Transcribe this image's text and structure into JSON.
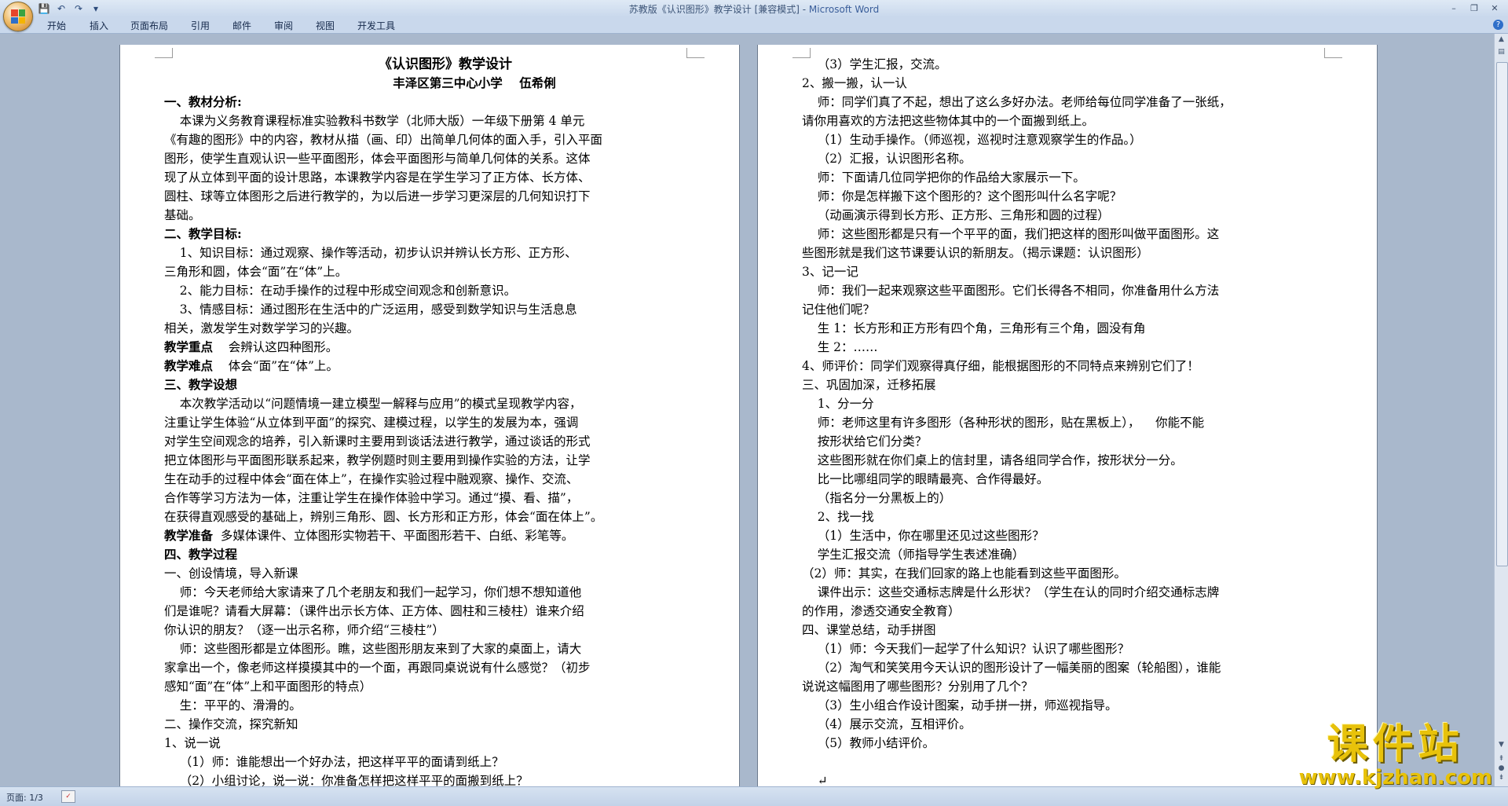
{
  "window": {
    "title": "苏教版《认识图形》教学设计 [兼容模式] - ",
    "app_name": "Microsoft Word",
    "minimize": "–",
    "restore": "❐",
    "close": "✕"
  },
  "quick_access": {
    "save": "💾",
    "undo": "↶",
    "redo": "↷",
    "more": "▾"
  },
  "ribbon_tabs": [
    "开始",
    "插入",
    "页面布局",
    "引用",
    "邮件",
    "审阅",
    "视图",
    "开发工具"
  ],
  "help": "?",
  "status": {
    "page": "页面: 1/3"
  },
  "watermark": {
    "title": "课件站",
    "url": "www.kjzhan.com"
  },
  "icons": {
    "office_button": "office-button-icon",
    "save": "save-icon",
    "undo": "undo-icon",
    "redo": "redo-icon",
    "help": "help-icon",
    "proofing": "proofing-icon"
  },
  "colors": {
    "title_bar": "#dfe9f5",
    "workspace": "#a9b8cc",
    "watermark": "#e8c20a"
  },
  "document": {
    "left_lines": [
      {
        "t": "《认识图形》教学设计",
        "s": "title"
      },
      {
        "t": "丰泽区第三中心小学    伍希俐",
        "s": "author"
      },
      {
        "t": "一、教材分析:",
        "s": "bold"
      },
      {
        "t": "    本课为义务教育课程标准实验教科书数学（北师大版）一年级下册第 4 单元"
      },
      {
        "t": "《有趣的图形》中的内容，教材从描（画、印）出简单几何体的面入手，引入平面"
      },
      {
        "t": "图形，使学生直观认识一些平面图形，体会平面图形与简单几何体的关系。这体"
      },
      {
        "t": "现了从立体到平面的设计思路，本课教学内容是在学生学习了正方体、长方体、"
      },
      {
        "t": "圆柱、球等立体图形之后进行教学的，为以后进一步学习更深层的几何知识打下"
      },
      {
        "t": "基础。"
      },
      {
        "t": "二、教学目标:",
        "s": "bold"
      },
      {
        "t": "    1、知识目标：通过观察、操作等活动，初步认识并辨认长方形、正方形、"
      },
      {
        "t": "三角形和圆，体会“面”在“体”上。"
      },
      {
        "t": "    2、能力目标：在动手操作的过程中形成空间观念和创新意识。"
      },
      {
        "t": "    3、情感目标：通过图形在生活中的广泛运用，感受到数学知识与生活息息"
      },
      {
        "t": "相关，激发学生对数学学习的兴趣。"
      },
      {
        "t": "教学重点",
        "s": "bold",
        "rest": "    会辨认这四种图形。"
      },
      {
        "t": "教学难点",
        "s": "bold",
        "rest": "    体会“面”在“体”上。"
      },
      {
        "t": "三、教学设想",
        "s": "bold"
      },
      {
        "t": "    本次教学活动以“问题情境一建立模型一解释与应用”的模式呈现教学内容，"
      },
      {
        "t": "注重让学生体验“从立体到平面”的探究、建模过程，以学生的发展为本，强调"
      },
      {
        "t": "对学生空间观念的培养，引入新课时主要用到谈话法进行教学，通过谈话的形式"
      },
      {
        "t": "把立体图形与平面图形联系起来，教学例题时则主要用到操作实验的方法，让学"
      },
      {
        "t": "生在动手的过程中体会“面在体上”，在操作实验过程中融观察、操作、交流、"
      },
      {
        "t": "合作等学习方法为一体，注重让学生在操作体验中学习。通过“摸、看、描”，"
      },
      {
        "t": "在获得直观感受的基础上，辨别三角形、圆、长方形和正方形，体会“面在体上”。"
      },
      {
        "t": "教学准备",
        "s": "bold",
        "rest": "  多媒体课件、立体图形实物若干、平面图形若干、白纸、彩笔等。"
      },
      {
        "t": "四、教学过程",
        "s": "bold"
      },
      {
        "t": "一、创设情境，导入新课"
      },
      {
        "t": "    师：今天老师给大家请来了几个老朋友和我们一起学习，你们想不想知道他"
      },
      {
        "t": "们是谁呢？请看大屏幕：（课件出示长方体、正方体、圆柱和三棱柱）谁来介绍"
      },
      {
        "t": "你认识的朋友？（逐一出示名称，师介绍“三棱柱”）"
      },
      {
        "t": "    师：这些图形都是立体图形。瞧，这些图形朋友来到了大家的桌面上，请大"
      },
      {
        "t": "家拿出一个，像老师这样摸摸其中的一个面，再跟同桌说说有什么感觉？（初步"
      },
      {
        "t": "感知“面”在“体”上和平面图形的特点）"
      },
      {
        "t": "    生：平平的、滑滑的。"
      },
      {
        "t": "二、操作交流，探究新知"
      },
      {
        "t": "1、说一说"
      },
      {
        "t": "    （1）师：谁能想出一个好办法，把这样平平的面请到纸上？"
      },
      {
        "t": "    （2）小组讨论，说一说：你准备怎样把这样平平的面搬到纸上？"
      }
    ],
    "right_lines": [
      {
        "t": "    （3）学生汇报，交流。"
      },
      {
        "t": "2、搬一搬，认一认"
      },
      {
        "t": "    师：同学们真了不起，想出了这么多好办法。老师给每位同学准备了一张纸，"
      },
      {
        "t": "请你用喜欢的方法把这些物体其中的一个面搬到纸上。"
      },
      {
        "t": "    （1）生动手操作。（师巡视，巡视时注意观察学生的作品。）"
      },
      {
        "t": "    （2）汇报，认识图形名称。"
      },
      {
        "t": "    师：下面请几位同学把你的作品给大家展示一下。"
      },
      {
        "t": "    师：你是怎样搬下这个图形的？这个图形叫什么名字呢？"
      },
      {
        "t": "    （动画演示得到长方形、正方形、三角形和圆的过程）"
      },
      {
        "t": "    师：这些图形都是只有一个平平的面，我们把这样的图形叫做平面图形。这"
      },
      {
        "t": "些图形就是我们这节课要认识的新朋友。（揭示课题：认识图形）"
      },
      {
        "t": "3、记一记"
      },
      {
        "t": "    师：我们一起来观察这些平面图形。它们长得各不相同，你准备用什么方法"
      },
      {
        "t": "记住他们呢？"
      },
      {
        "t": "    生 1：长方形和正方形有四个角，三角形有三个角，圆没有角"
      },
      {
        "t": "    生 2：……"
      },
      {
        "t": "4、师评价：同学们观察得真仔细，能根据图形的不同特点来辨别它们了！"
      },
      {
        "t": "三、巩固加深，迁移拓展"
      },
      {
        "t": "    1、分一分"
      },
      {
        "t": "    师：老师这里有许多图形（各种形状的图形，贴在黑板上），    你能不能"
      },
      {
        "t": "    按形状给它们分类？"
      },
      {
        "t": "    这些图形就在你们桌上的信封里，请各组同学合作，按形状分一分。"
      },
      {
        "t": "    比一比哪组同学的眼睛最亮、合作得最好。"
      },
      {
        "t": "    （指名分一分黑板上的）"
      },
      {
        "t": "    2、找一找"
      },
      {
        "t": "    （1）生活中，你在哪里还见过这些图形？"
      },
      {
        "t": "    学生汇报交流（师指导学生表述准确）"
      },
      {
        "t": "（2）师：其实，在我们回家的路上也能看到这些平面图形。"
      },
      {
        "t": "    课件出示：这些交通标志牌是什么形状？（学生在认的同时介绍交通标志牌"
      },
      {
        "t": "的作用，渗透交通安全教育）"
      },
      {
        "t": "四、课堂总结，动手拼图"
      },
      {
        "t": "    （1）师：今天我们一起学了什么知识？认识了哪些图形？"
      },
      {
        "t": "    （2）淘气和笑笑用今天认识的图形设计了一幅美丽的图案（轮船图），谁能"
      },
      {
        "t": "说说这幅图用了哪些图形？分别用了几个？"
      },
      {
        "t": "    （3）生小组合作设计图案，动手拼一拼，师巡视指导。"
      },
      {
        "t": "    （4）展示交流，互相评价。"
      },
      {
        "t": "    （5）教师小结评价。"
      },
      {
        "t": ""
      },
      {
        "t": "    ↵"
      }
    ]
  }
}
